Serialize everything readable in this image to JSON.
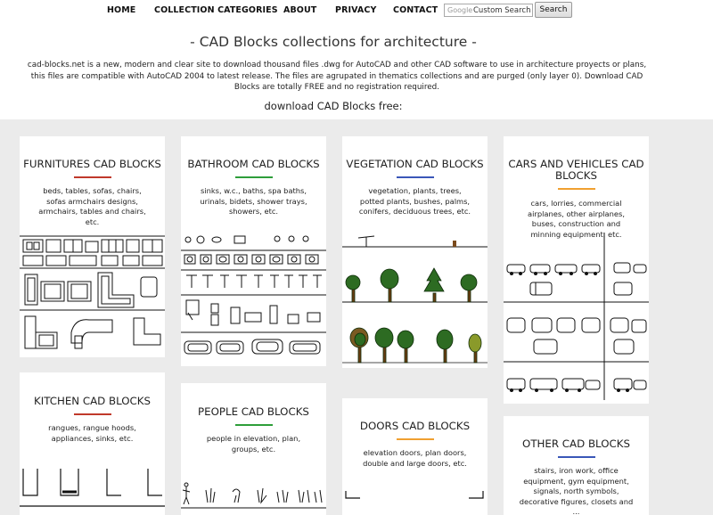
{
  "nav": {
    "home": "HOME",
    "collection_categories": "COLLECTION CATEGORIES",
    "about": "ABOUT",
    "privacy": "PRIVACY",
    "contact": "CONTACT"
  },
  "search": {
    "brand": "Google",
    "placeholder": "Custom Search",
    "button": "Search"
  },
  "header": {
    "title": "- CAD Blocks collections for architecture -",
    "intro": "cad-blocks.net is a new, modern and clear site to download thousand files .dwg for AutoCAD and other CAD software to use in architecture proyects or plans, this files are compatible with AutoCAD 2004 to latest release. The files are agrupated in thematics collections and are purged (only layer 0). Download CAD Blocks are totally FREE and no registration required.",
    "subtitle": "download CAD Blocks free:"
  },
  "cards": {
    "furnitures": {
      "title": "FURNITURES CAD BLOCKS",
      "desc": "beds, tables, sofas, chairs, sofas armchairs designs, armchairs, tables and chairs, etc.",
      "accent": "#c0392b"
    },
    "bathroom": {
      "title": "BATHROOM CAD BLOCKS",
      "desc": "sinks, w.c., baths, spa baths, urinals, bidets, shower trays, showers, etc.",
      "accent": "#2e9e3a"
    },
    "vegetation": {
      "title": "VEGETATION CAD BLOCKS",
      "desc": "vegetation, plants, trees, potted plants, bushes, palms, conifers, deciduous trees, etc.",
      "accent": "#3a57b8"
    },
    "cars": {
      "title": "CARS AND VEHICLES CAD BLOCKS",
      "desc": "cars, lorries, commercial airplanes, other airplanes, buses, construction and minning equipment, etc.",
      "accent": "#f0a030"
    },
    "kitchen": {
      "title": "KITCHEN CAD BLOCKS",
      "desc": "rangues, rangue hoods, appliances, sinks, etc.",
      "accent": "#c0392b"
    },
    "people": {
      "title": "PEOPLE CAD BLOCKS",
      "desc": "people in elevation, plan, groups, etc.",
      "accent": "#2e9e3a"
    },
    "doors": {
      "title": "DOORS CAD BLOCKS",
      "desc": "elevation doors, plan doors, double and large doors, etc.",
      "accent": "#f0a030"
    },
    "other": {
      "title": "OTHER CAD BLOCKS",
      "desc": "stairs, iron work, office equipment, gym equipment, signals, north symbols, decorative figures, closets and ...",
      "accent": "#3a57b8"
    }
  }
}
